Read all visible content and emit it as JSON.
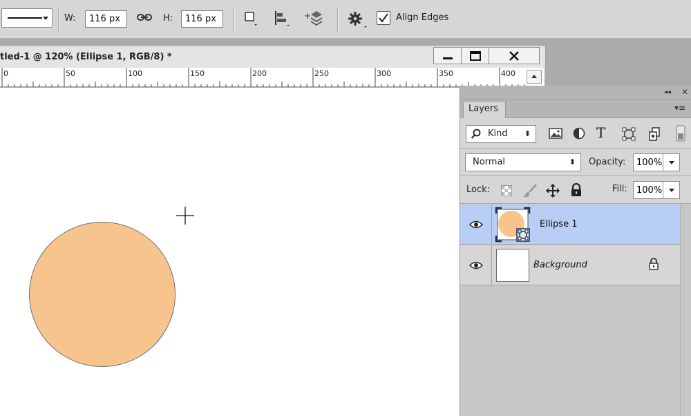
{
  "options_bar": {
    "width_label": "W:",
    "width_value": "116 px",
    "height_label": "H:",
    "height_value": "116 px",
    "align_edges_label": "Align Edges",
    "align_edges_checked": true,
    "icons": [
      "stroke-type-icon",
      "link-dimensions-icon",
      "path-operations-icon",
      "path-alignment-icon",
      "path-arrangement-icon",
      "gear-icon"
    ]
  },
  "document": {
    "title": "tled-1 @ 120% (Ellipse 1, RGB/8) *",
    "window_buttons": [
      "minimize-icon",
      "maximize-icon",
      "close-icon"
    ],
    "ruler_labels": [
      "0",
      "50",
      "100",
      "150",
      "200",
      "250",
      "300",
      "350",
      "400"
    ]
  },
  "canvas": {
    "background_color": "#ffffff",
    "shape": {
      "name": "Ellipse 1",
      "fill_color": "#f7c48e",
      "stroke_color": "#6f6f6f"
    }
  },
  "layers_panel": {
    "tab_label": "Layers",
    "filter": {
      "kind_label": "Kind",
      "icons": [
        "pixel-filter-icon",
        "adjustment-filter-icon",
        "type-filter-icon",
        "shape-filter-icon",
        "smart-object-filter-icon"
      ]
    },
    "blend_mode": "Normal",
    "opacity_label": "Opacity:",
    "opacity_value": "100%",
    "lock_label": "Lock:",
    "fill_label": "Fill:",
    "fill_value": "100%",
    "selection_color": "#b8cef5",
    "layers": [
      {
        "name": "Ellipse 1",
        "visible": true,
        "selected": true,
        "type": "shape"
      },
      {
        "name": "Background",
        "visible": true,
        "selected": false,
        "locked": true,
        "type": "background"
      }
    ]
  }
}
